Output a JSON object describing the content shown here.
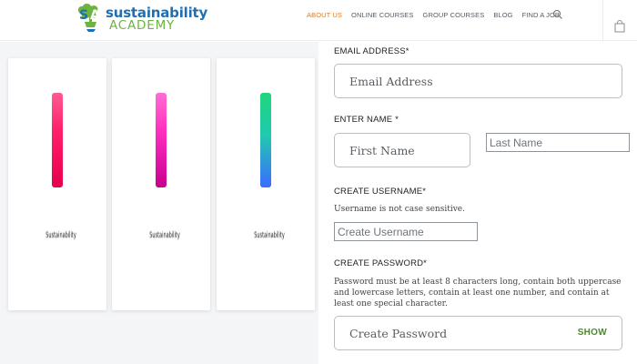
{
  "brand": {
    "line1": "sustainability",
    "line2": "ACADEMY",
    "mark_text": "SA",
    "primary_color": "#1f6fb2",
    "secondary_color": "#6cb33f"
  },
  "nav": {
    "items": [
      {
        "label": "ABOUT US",
        "active": true
      },
      {
        "label": "ONLINE COURSES",
        "active": false
      },
      {
        "label": "GROUP COURSES",
        "active": false
      },
      {
        "label": "BLOG",
        "active": false
      },
      {
        "label": "FIND A JOB",
        "active": false
      }
    ],
    "active_color": "#e07b24",
    "icons": [
      "search-icon",
      "shopping-bag-icon"
    ]
  },
  "gallery": {
    "cards": [
      {
        "name": "Sustainability",
        "thumb_colors": [
          "#ff1f6b",
          "#e4004f"
        ]
      },
      {
        "name": "Sustainability",
        "thumb_colors": [
          "#ff2fbf",
          "#c8008f"
        ]
      },
      {
        "name": "Sustainability",
        "thumb_colors": [
          "#1fd67a",
          "#3a6bff"
        ]
      }
    ]
  },
  "form": {
    "email": {
      "label": "EMAIL ADDRESS*",
      "placeholder": "Email Address",
      "value": ""
    },
    "name": {
      "label": "ENTER NAME *",
      "first_placeholder": "First Name",
      "last_placeholder": "Last Name"
    },
    "username": {
      "label": "CREATE USERNAME*",
      "hint": "Username is not case sensitive.",
      "placeholder": "Create Username"
    },
    "password": {
      "label": "CREATE PASSWORD*",
      "hint": "Password must be at least 8 characters long, contain both uppercase and lowercase letters, contain at least one number, and contain at least one special character.",
      "placeholder": "Create Password",
      "show_label": "SHOW"
    }
  }
}
